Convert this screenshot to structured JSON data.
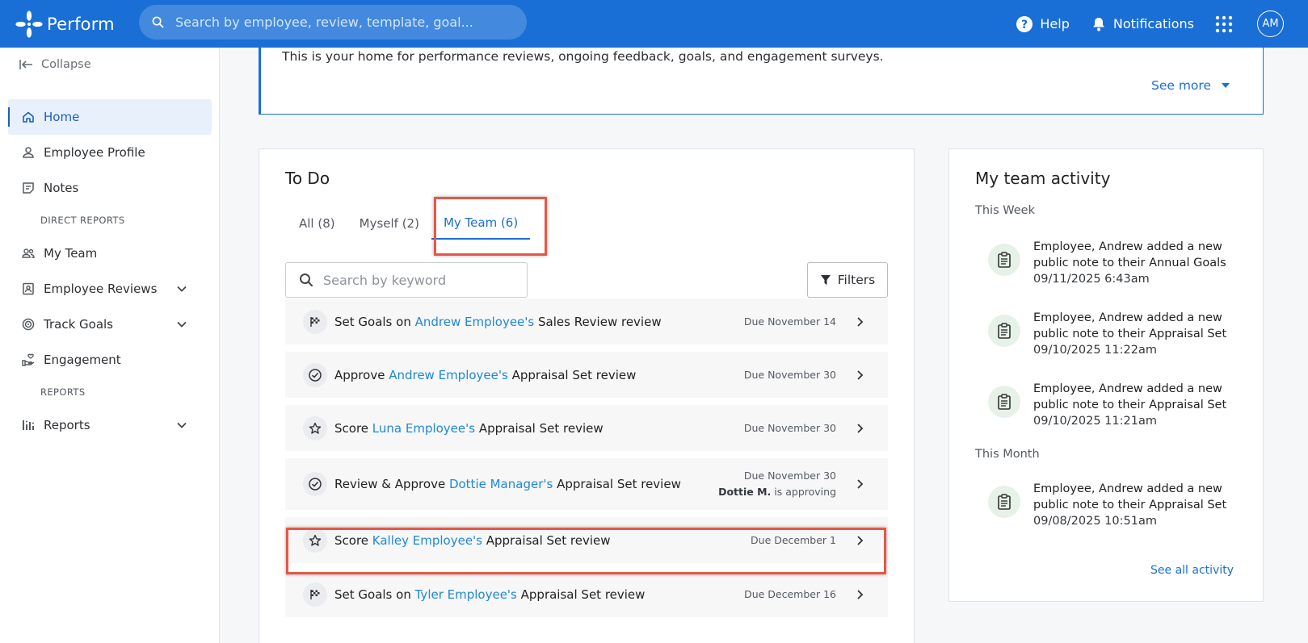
{
  "header": {
    "brand": "Perform",
    "search_placeholder": "Search by employee, review, template, goal...",
    "help": "Help",
    "notifications": "Notifications",
    "avatar_initials": "AM",
    "bar_color": "#1a6fd6"
  },
  "sidebar": {
    "collapse": "Collapse",
    "items": [
      {
        "label": "Home",
        "icon": "home-icon"
      },
      {
        "label": "Employee Profile",
        "icon": "person-icon"
      },
      {
        "label": "Notes",
        "icon": "notes-icon"
      },
      {
        "label": "My Team",
        "icon": "team-icon"
      },
      {
        "label": "Employee Reviews",
        "icon": "review-icon"
      },
      {
        "label": "Track Goals",
        "icon": "target-icon"
      },
      {
        "label": "Engagement",
        "icon": "engagement-icon"
      },
      {
        "label": "Reports",
        "icon": "reports-icon"
      }
    ],
    "section_direct_reports": "DIRECT REPORTS",
    "section_reports": "REPORTS"
  },
  "banner": {
    "text": "This is your home for performance reviews, ongoing feedback, goals, and engagement surveys.",
    "see_more": "See more"
  },
  "todo": {
    "title": "To Do",
    "tabs": [
      "All (8)",
      "Myself (2)",
      "My Team (6)"
    ],
    "search_placeholder": "Search by keyword",
    "filters": "Filters",
    "rows": [
      {
        "icon": "flag-icon",
        "pre": "Set Goals on ",
        "link": "Andrew Employee's",
        "post": " Sales Review review",
        "due": "Due November 14",
        "sub": ""
      },
      {
        "icon": "check-circle-icon",
        "pre": "Approve ",
        "link": "Andrew Employee's",
        "post": " Appraisal Set review",
        "due": "Due November 30",
        "sub": ""
      },
      {
        "icon": "star-icon",
        "pre": "Score ",
        "link": "Luna Employee's",
        "post": " Appraisal Set review",
        "due": "Due November 30",
        "sub": ""
      },
      {
        "icon": "check-circle-icon",
        "pre": "Review & Approve ",
        "link": "Dottie Manager's",
        "post": " Appraisal Set review",
        "due": "Due November 30",
        "sub_bold": "Dottie M.",
        "sub": " is approving"
      },
      {
        "icon": "star-icon",
        "pre": "Score ",
        "link": "Kalley Employee's",
        "post": " Appraisal Set review",
        "due": "Due December 1",
        "sub": ""
      },
      {
        "icon": "flag-icon",
        "pre": "Set Goals on ",
        "link": "Tyler Employee's",
        "post": " Appraisal Set review",
        "due": "Due December 16",
        "sub": ""
      }
    ],
    "link_color": "#1e88d6",
    "highlight_color": "#e55848"
  },
  "activity": {
    "title": "My team activity",
    "this_week": "This Week",
    "this_month": "This Month",
    "items": [
      {
        "text": "Employee, Andrew added a new public note to their Annual Goals",
        "date": "09/11/2025 6:43am"
      },
      {
        "text": "Employee, Andrew added a new public note to their Appraisal Set",
        "date": "09/10/2025 11:22am"
      },
      {
        "text": "Employee, Andrew added a new public note to their Appraisal Set",
        "date": "09/10/2025 11:21am"
      },
      {
        "text": "Employee, Andrew added a new public note to their Appraisal Set",
        "date": "09/08/2025 10:51am"
      }
    ],
    "see_all": "See all activity"
  }
}
